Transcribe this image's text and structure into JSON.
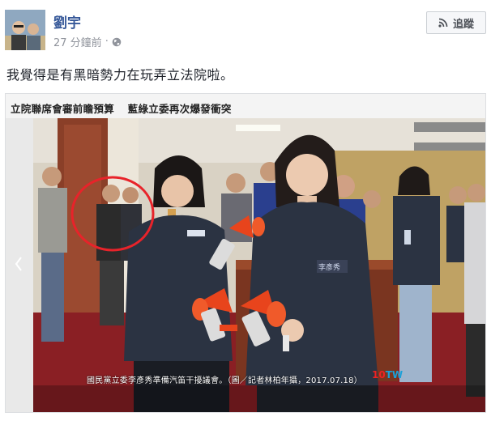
{
  "post": {
    "author": "劉宇",
    "time": "27 分鐘前",
    "separator": "·",
    "follow_label": "追蹤",
    "text": "我覺得是有黑暗勢力在玩弄立法院啦。"
  },
  "media": {
    "headline_left": "立院聯席會審前瞻預算",
    "headline_right": "藍綠立委再次爆發衝突",
    "caption": "國民黨立委李彥秀準備汽笛干擾議會。（圖／記者林柏年攝，2017.07.18）",
    "watermark_num": "10",
    "watermark_text": "TW"
  },
  "colors": {
    "link": "#365899",
    "highlight_circle": "#e8232a",
    "jacket": "#2b3342",
    "horn_red": "#e8441c"
  }
}
